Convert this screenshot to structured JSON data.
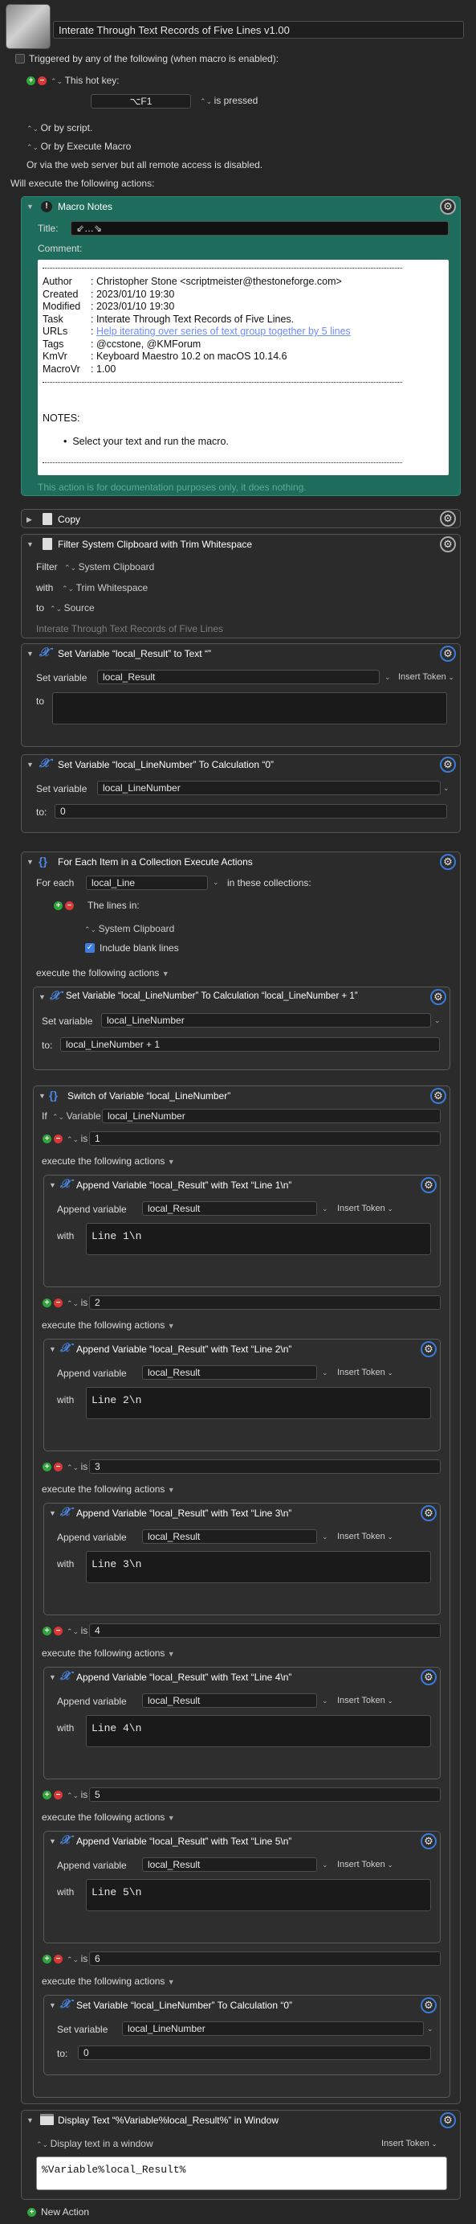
{
  "header": {
    "title": "Interate Through Text Records of Five Lines v1.00"
  },
  "triggers": {
    "triggered_label": "Triggered by any of the following (when macro is enabled):",
    "hotkey_label": "This hot key:",
    "hotkey_value": "⌥F1",
    "hotkey_state": "is pressed",
    "or_script": "Or by script.",
    "or_execute": "Or by Execute Macro",
    "web_server": "Or via the web server but all remote access is disabled.",
    "will_execute": "Will execute the following actions:"
  },
  "notes": {
    "header": "Macro Notes",
    "title_label": "Title:",
    "title_value": "⇙…⇘",
    "comment_label": "Comment:",
    "rows": [
      {
        "k": "Author",
        "v": "Christopher Stone <scriptmeister@thestoneforge.com>"
      },
      {
        "k": "Created",
        "v": "2023/01/10 19:30"
      },
      {
        "k": "Modified",
        "v": "2023/01/10 19:30"
      },
      {
        "k": "Task",
        "v": "Interate Through Text Records of Five Lines."
      },
      {
        "k": "URLs",
        "v": "Help iterating over series of text group together by 5 lines"
      },
      {
        "k": "Tags",
        "v": "@ccstone, @KMForum"
      },
      {
        "k": "KmVr",
        "v": "Keyboard Maestro 10.2 on macOS 10.14.6"
      },
      {
        "k": "MacroVr",
        "v": "1.00"
      }
    ],
    "notes_heading": "NOTES:",
    "bullet": "Select your text and run the macro.",
    "footer": "This action is for documentation purposes only, it does nothing."
  },
  "copy": {
    "header": "Copy"
  },
  "filter": {
    "header": "Filter System Clipboard with Trim Whitespace",
    "filter_label": "Filter",
    "filter_value": "System Clipboard",
    "with_label": "with",
    "with_value": "Trim Whitespace",
    "to_label": "to",
    "to_value": "Source",
    "footer": "Interate Through Text Records of Five Lines"
  },
  "set_result": {
    "header": "Set Variable “local_Result” to Text “”",
    "set_label": "Set variable",
    "var": "local_Result",
    "insert": "Insert Token",
    "to_label": "to"
  },
  "set_linenum": {
    "header": "Set Variable “local_LineNumber” To Calculation “0”",
    "set_label": "Set variable",
    "var": "local_LineNumber",
    "to_label": "to:",
    "to_value": "0"
  },
  "foreach": {
    "header": "For Each Item in a Collection Execute Actions",
    "for_each_label": "For each",
    "var": "local_Line",
    "in_collections": "in these collections:",
    "lines_in": "The lines in:",
    "clipboard": "System Clipboard",
    "include_blank": "Include blank lines",
    "execute": "execute the following actions"
  },
  "incr": {
    "header": "Set Variable “local_LineNumber” To Calculation “local_LineNumber + 1”",
    "set_label": "Set variable",
    "var": "local_LineNumber",
    "to_label": "to:",
    "to_value": "local_LineNumber + 1"
  },
  "switch": {
    "header": "Switch of Variable “local_LineNumber”",
    "if_label": "If",
    "var_type": "Variable",
    "var": "local_LineNumber",
    "is_label": "is",
    "execute": "execute the following actions",
    "cases": [
      {
        "value": "1",
        "header": "Append Variable “local_Result” with Text “Line 1\\n”",
        "append_label": "Append variable",
        "var": "local_Result",
        "insert": "Insert Token",
        "with_label": "with",
        "text": "Line 1\\n"
      },
      {
        "value": "2",
        "header": "Append Variable “local_Result” with Text “Line 2\\n”",
        "append_label": "Append variable",
        "var": "local_Result",
        "insert": "Insert Token",
        "with_label": "with",
        "text": "Line 2\\n"
      },
      {
        "value": "3",
        "header": "Append Variable “local_Result” with Text “Line 3\\n”",
        "append_label": "Append variable",
        "var": "local_Result",
        "insert": "Insert Token",
        "with_label": "with",
        "text": "Line 3\\n"
      },
      {
        "value": "4",
        "header": "Append Variable “local_Result” with Text “Line 4\\n”",
        "append_label": "Append variable",
        "var": "local_Result",
        "insert": "Insert Token",
        "with_label": "with",
        "text": "Line 4\\n"
      },
      {
        "value": "5",
        "header": "Append Variable “local_Result” with Text “Line 5\\n”",
        "append_label": "Append variable",
        "var": "local_Result",
        "insert": "Insert Token",
        "with_label": "with",
        "text": "Line 5\\n"
      }
    ],
    "case6": {
      "value": "6",
      "header": "Set Variable “local_LineNumber” To Calculation “0”",
      "set_label": "Set variable",
      "var": "local_LineNumber",
      "to_label": "to:",
      "to_value": "0"
    }
  },
  "display": {
    "header": "Display Text “%Variable%local_Result%” in Window",
    "mode": "Display text in a window",
    "insert": "Insert Token",
    "text": "%Variable%local_Result%"
  },
  "footer": {
    "new_action": "New Action"
  }
}
